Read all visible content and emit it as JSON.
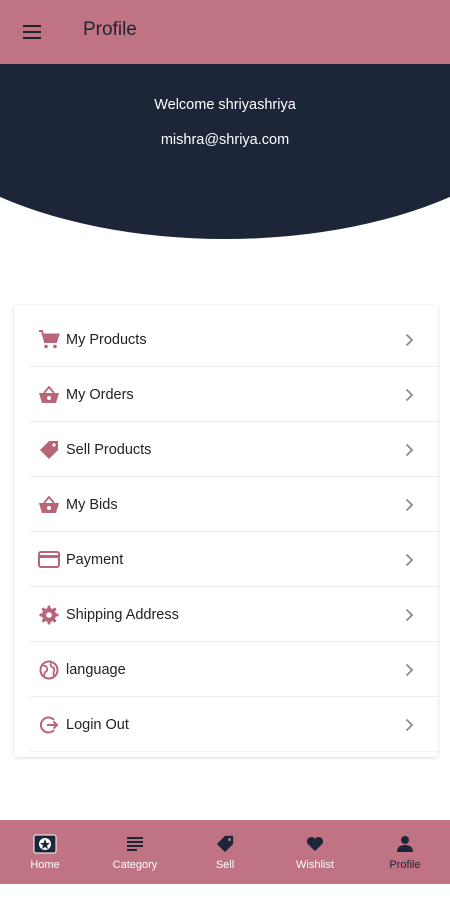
{
  "appbar": {
    "title": "Profile",
    "menu_icon": "hamburger-menu-icon"
  },
  "header": {
    "welcome": "Welcome shriyashriya",
    "email": "mishra@shriya.com"
  },
  "menu": {
    "items": [
      {
        "label": "My Products",
        "icon": "cart-icon"
      },
      {
        "label": "My Orders",
        "icon": "basket-icon"
      },
      {
        "label": "Sell Products",
        "icon": "tag-icon"
      },
      {
        "label": "My Bids",
        "icon": "basket-icon"
      },
      {
        "label": "Payment",
        "icon": "credit-card-icon"
      },
      {
        "label": "Shipping Address",
        "icon": "gear-icon"
      },
      {
        "label": "language",
        "icon": "globe-icon"
      },
      {
        "label": "Login Out",
        "icon": "logout-icon"
      }
    ]
  },
  "bottom_nav": {
    "items": [
      {
        "label": "Home",
        "icon": "home-icon"
      },
      {
        "label": "Category",
        "icon": "list-icon"
      },
      {
        "label": "Sell",
        "icon": "tag-icon"
      },
      {
        "label": "Wishlist",
        "icon": "heart-icon"
      },
      {
        "label": "Profile",
        "icon": "person-icon"
      }
    ],
    "active": "Profile"
  },
  "colors": {
    "accent": "#bf7383",
    "header_dark": "#1d2538",
    "icon_pink": "#b8657a"
  }
}
